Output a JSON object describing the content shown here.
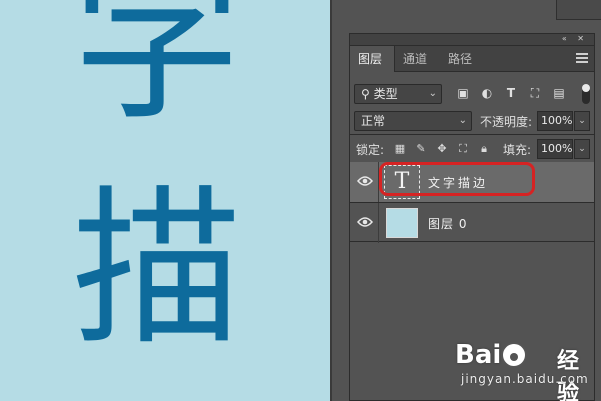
{
  "canvas": {
    "char_1": "字",
    "char_2": "描",
    "background_color": "#b5dce5",
    "text_color": "#0e6b9c"
  },
  "panel": {
    "tabs": [
      "图层",
      "通道",
      "路径"
    ],
    "active_tab": "图层",
    "filter": {
      "kind_label": "类型",
      "icons": [
        "image-filter-icon",
        "adjustment-filter-icon",
        "type-filter-icon",
        "shape-filter-icon",
        "smart-object-filter-icon"
      ]
    },
    "blend_mode": "正常",
    "opacity_label": "不透明度:",
    "opacity_value": "100%",
    "lock_label": "锁定:",
    "lock_icons": [
      "lock-transparent-icon",
      "lock-image-icon",
      "lock-position-icon",
      "lock-artboard-icon",
      "lock-all-icon"
    ],
    "fill_label": "填充:",
    "fill_value": "100%",
    "layers": [
      {
        "name": "文字描边",
        "thumb": "T",
        "type": "text",
        "selected": true
      },
      {
        "name": "图层 0",
        "type": "pixel",
        "selected": false
      }
    ]
  },
  "watermark": {
    "logo": "Bai",
    "logo_suffix": "经验",
    "url": "jingyan.baidu.com"
  },
  "colors": {
    "panel_bg": "#535353",
    "selected_layer_bg": "#6a6a6a",
    "highlight_outline": "#d62323"
  }
}
